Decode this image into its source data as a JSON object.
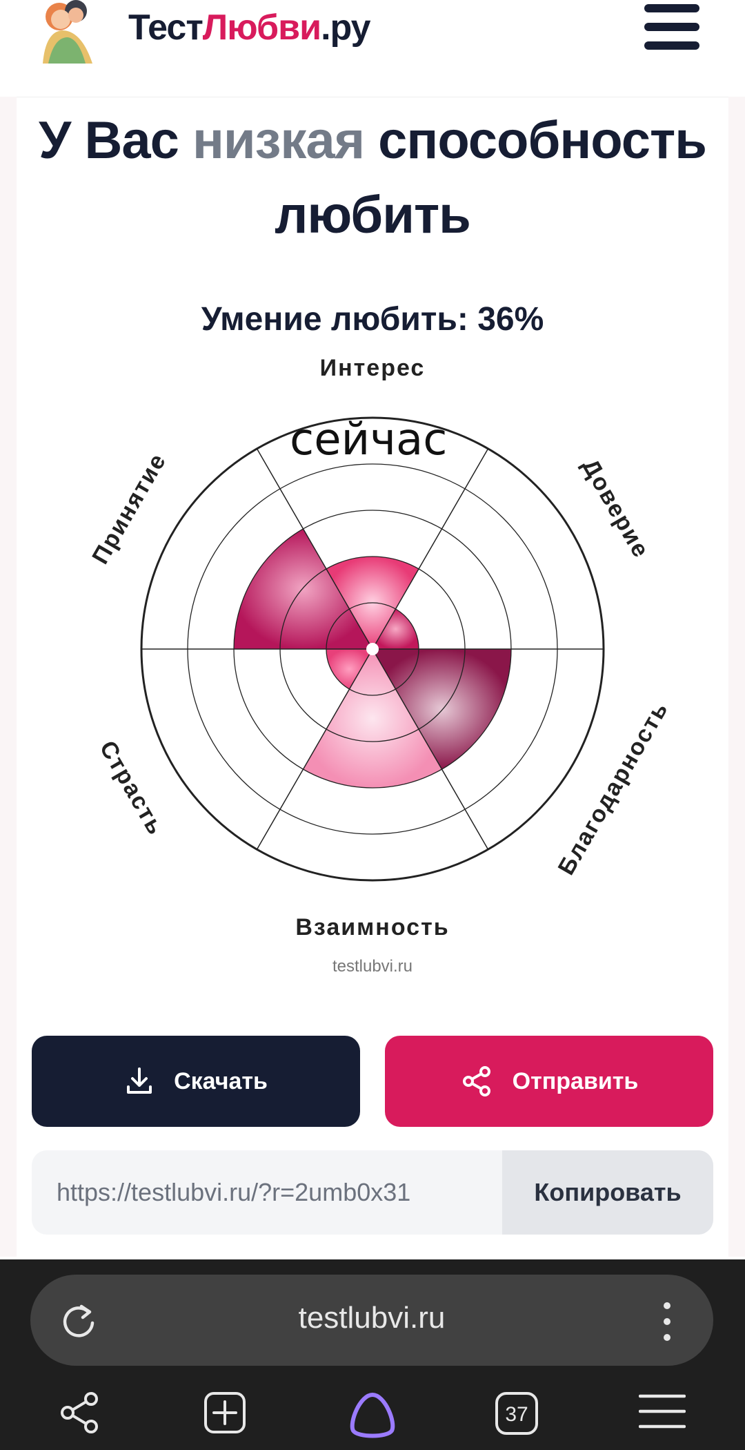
{
  "header": {
    "logo_part1": "Тест",
    "logo_part2": "Любви",
    "logo_part3": ".ру"
  },
  "result": {
    "headline_before": "У Вас ",
    "headline_level": "низкая",
    "headline_after": " способность любить",
    "score_text": "Умение любить: 36%",
    "overlay_text": "сейчас"
  },
  "chart_data": {
    "type": "polar-area",
    "categories": [
      "Интерес",
      "Доверие",
      "Благодарность",
      "Взаимность",
      "Страсть",
      "Принятие"
    ],
    "values": [
      2,
      1,
      3,
      3,
      1,
      3
    ],
    "max": 5,
    "colors": [
      "#e83b76",
      "#c2185b",
      "#8a1649",
      "#f7a8c4",
      "#e8407a",
      "#b5165a"
    ]
  },
  "watermark": "testlubvi.ru",
  "actions": {
    "download_label": "Скачать",
    "send_label": "Отправить"
  },
  "share": {
    "url": "https://testlubvi.ru/?r=2umb0x31",
    "copy_label": "Копировать"
  },
  "browser": {
    "address": "testlubvi.ru",
    "tabs_count": "37"
  }
}
